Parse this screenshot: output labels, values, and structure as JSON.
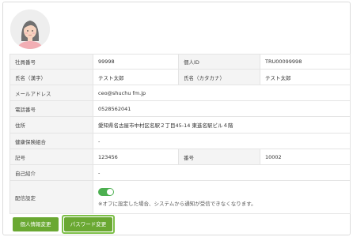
{
  "profile": {
    "rows": [
      {
        "label": "社員番号",
        "value": "99998",
        "label2": "個人ID",
        "value2": "TRU00099998"
      },
      {
        "label": "氏名（漢字）",
        "value": "テスト太郎",
        "label2": "氏名（カタカナ）",
        "value2": "テスト太郎"
      },
      {
        "label": "メールアドレス",
        "value": "ceo@shuchu fm.jp"
      },
      {
        "label": "電話番号",
        "value": "0528562041"
      },
      {
        "label": "住所",
        "value": "愛知県名古屋市中村区名駅２丁目45-14 東進名駅ビル４階"
      },
      {
        "label": "健康保険組合",
        "value": "-"
      },
      {
        "label": "記号",
        "value": "123456",
        "label2": "番号",
        "value2": "10002"
      },
      {
        "label": "自己紹介",
        "value": "-"
      }
    ],
    "notification": {
      "label": "配信設定",
      "enabled": true,
      "note": "※オフに設定した場合、システムから通知が受信できなくなります。"
    }
  },
  "actions": {
    "edit_profile": "個人情報変更",
    "change_password": "パスワード変更"
  },
  "colors": {
    "accent_green": "#6aa832",
    "label_bg": "#f4f4f4"
  }
}
